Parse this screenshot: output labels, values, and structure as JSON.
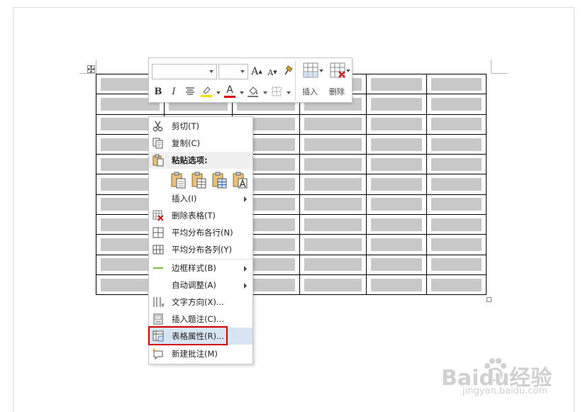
{
  "mini_toolbar": {
    "font_name_value": "",
    "font_size_value": "",
    "grow_font_icon": "A",
    "shrink_font_icon": "A",
    "bold_label": "B",
    "italic_label": "I",
    "font_color_label": "A",
    "insert_label": "插入",
    "delete_label": "删除"
  },
  "context_menu": {
    "items": [
      {
        "label": "剪切(T)",
        "icon": "scissors-icon"
      },
      {
        "label": "复制(C)",
        "icon": "copy-icon"
      },
      {
        "label": "粘贴选项:",
        "icon": "paste-icon"
      },
      {
        "label": "插入(I)",
        "icon": ""
      },
      {
        "label": "删除表格(T)",
        "icon": "delete-table-icon"
      },
      {
        "label": "平均分布各行(N)",
        "icon": "distribute-rows-icon"
      },
      {
        "label": "平均分布各列(Y)",
        "icon": "distribute-columns-icon"
      },
      {
        "label": "边框样式(B)",
        "icon": "border-style-icon"
      },
      {
        "label": "自动调整(A)",
        "icon": ""
      },
      {
        "label": "文字方向(X)...",
        "icon": "text-direction-icon"
      },
      {
        "label": "插入题注(C)...",
        "icon": "insert-caption-icon"
      },
      {
        "label": "表格属性(R)...",
        "icon": "table-properties-icon"
      },
      {
        "label": "新建批注(M)",
        "icon": "new-comment-icon"
      }
    ],
    "highlighted": "表格属性(R)..."
  },
  "table": {
    "rows": 11,
    "cols": 6
  },
  "colors": {
    "highlight_box": "#d40000",
    "menu_highlight": "#d7e4f2",
    "cell_fill": "#c8c8c8",
    "font_color_bar": "#d40000",
    "highlight_color_bar": "#f0e000"
  },
  "watermark": {
    "logo_text": "Baidu经验",
    "url": "jingyan.baidu.com"
  }
}
